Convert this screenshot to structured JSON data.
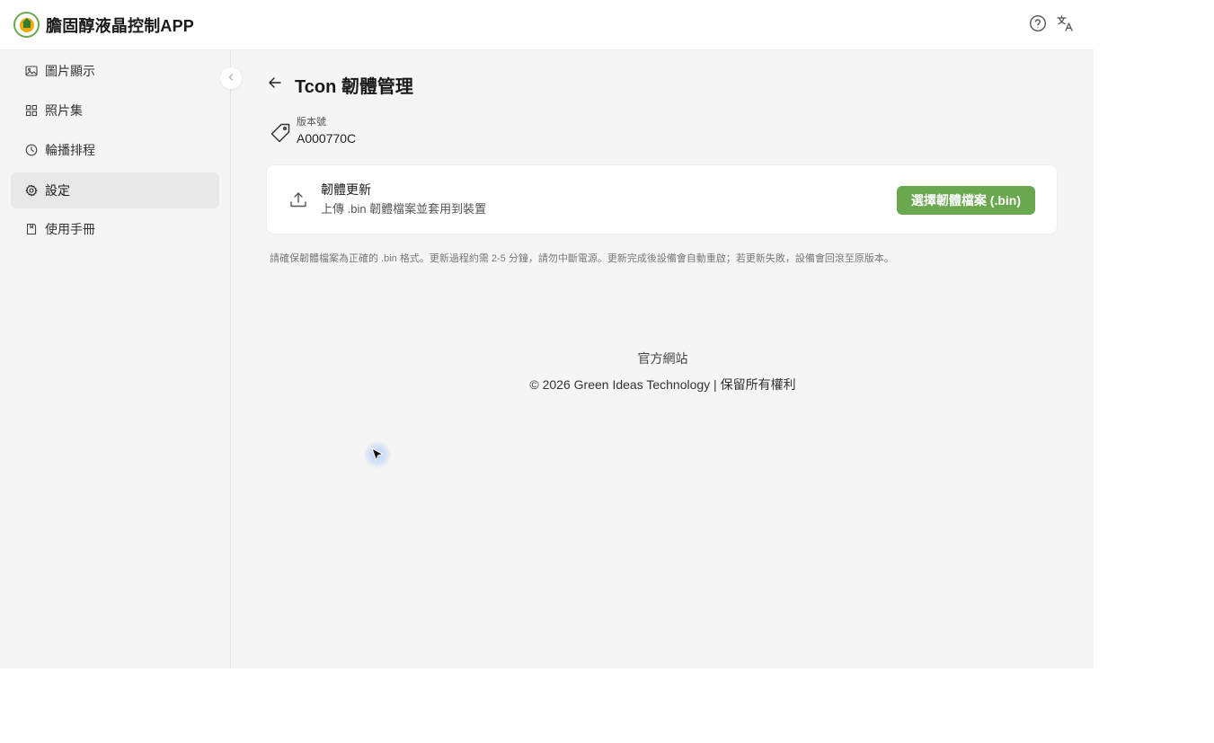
{
  "app": {
    "title": "膽固醇液晶控制APP",
    "brand_color": "#6aa84f"
  },
  "topbar": {
    "icons": [
      "help-circle-icon",
      "translate-icon"
    ]
  },
  "sidebar": {
    "items": [
      {
        "label": "圖片顯示",
        "icon": "image-icon",
        "active": false
      },
      {
        "label": "照片集",
        "icon": "grid-icon",
        "active": false
      },
      {
        "label": "輪播排程",
        "icon": "clock-icon",
        "active": false
      },
      {
        "label": "設定",
        "icon": "gear-icon",
        "active": true
      },
      {
        "label": "使用手冊",
        "icon": "book-icon",
        "active": false
      }
    ]
  },
  "page": {
    "title": "Tcon 韌體管理",
    "version_label": "版本號",
    "version_value": "A000770C"
  },
  "update_card": {
    "title": "韌體更新",
    "subtitle": "上傳 .bin 韌體檔案並套用到裝置",
    "button_label": "選擇韌體檔案 (.bin)"
  },
  "note": "請確保韌體檔案為正確的 .bin 格式。更新過程約需 2-5 分鐘，請勿中斷電源。更新完成後設備會自動重啟；若更新失敗，設備會回滾至原版本。",
  "footer": {
    "link": "官方網站",
    "copyright": "© 2026 Green Ideas Technology | 保留所有權利"
  }
}
